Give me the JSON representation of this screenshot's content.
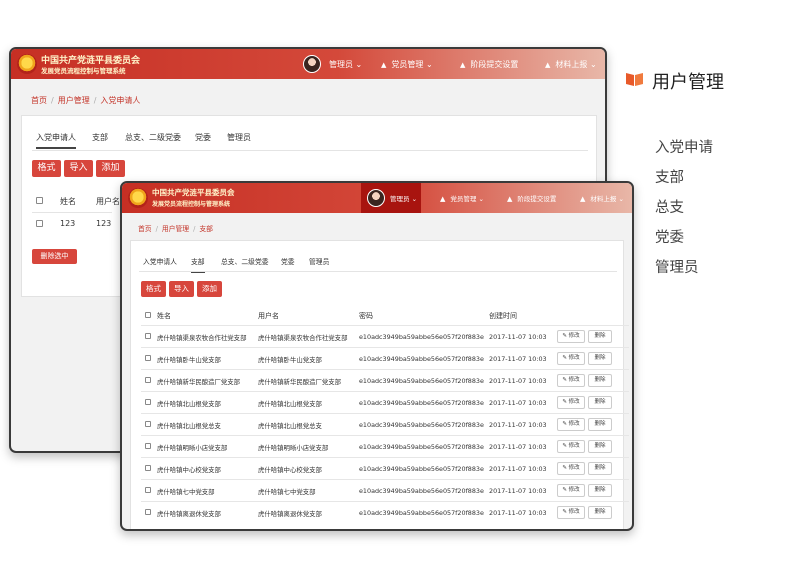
{
  "header": {
    "org_title": "中国共产党涟平县委员会",
    "org_subtitle": "发展党员流程控制与管理系统",
    "menu_admin": "管理员",
    "menu_party_manage": "党员管理",
    "menu_stage_settings": "阶段提交设置",
    "menu_material_report": "材料上报"
  },
  "back_window": {
    "breadcrumb": {
      "home": "首页",
      "level2": "用户管理",
      "level3": "入党申请人"
    },
    "tabs": [
      "入党申请人",
      "支部",
      "总支、二级党委",
      "党委",
      "管理员"
    ],
    "buttons": {
      "format": "格式",
      "import": "导入",
      "add": "添加"
    },
    "table": {
      "headers": [
        "姓名",
        "用户名"
      ],
      "rows": [
        [
          "123",
          "123"
        ]
      ]
    },
    "delete_selected": "删除选中"
  },
  "front_window": {
    "breadcrumb": {
      "home": "首页",
      "level2": "用户管理",
      "level3": "支部"
    },
    "tabs": [
      "入党申请人",
      "支部",
      "总支、二级党委",
      "党委",
      "管理员"
    ],
    "buttons": {
      "format": "格式",
      "import": "导入",
      "add": "添加"
    },
    "table": {
      "headers": [
        "姓名",
        "用户名",
        "密码",
        "创建时间"
      ],
      "edit_label": "修改",
      "delete_label": "删除",
      "rows": [
        {
          "name": "虎什哈镇渠泉农牧合作社党支部",
          "username": "虎什哈镇渠泉农牧合作社党支部",
          "password": "e10adc3949ba59abbe56e057f20f883e",
          "created": "2017-11-07 10:03"
        },
        {
          "name": "虎什哈镇卧牛山党支部",
          "username": "虎什哈镇卧牛山党支部",
          "password": "e10adc3949ba59abbe56e057f20f883e",
          "created": "2017-11-07 10:03"
        },
        {
          "name": "虎什哈镇新华民酿造厂党支部",
          "username": "虎什哈镇新华民酿造厂党支部",
          "password": "e10adc3949ba59abbe56e057f20f883e",
          "created": "2017-11-07 10:03"
        },
        {
          "name": "虎什哈镇北山根党支部",
          "username": "虎什哈镇北山根党支部",
          "password": "e10adc3949ba59abbe56e057f20f883e",
          "created": "2017-11-07 10:03"
        },
        {
          "name": "虎什哈镇北山根党总支",
          "username": "虎什哈镇北山根党总支",
          "password": "e10adc3949ba59abbe56e057f20f883e",
          "created": "2017-11-07 10:03"
        },
        {
          "name": "虎什哈镇明晰小店党支部",
          "username": "虎什哈镇明晰小店党支部",
          "password": "e10adc3949ba59abbe56e057f20f883e",
          "created": "2017-11-07 10:03"
        },
        {
          "name": "虎什哈镇中心校党支部",
          "username": "虎什哈镇中心校党支部",
          "password": "e10adc3949ba59abbe56e057f20f883e",
          "created": "2017-11-07 10:03"
        },
        {
          "name": "虎什哈镇七中党支部",
          "username": "虎什哈镇七中党支部",
          "password": "e10adc3949ba59abbe56e057f20f883e",
          "created": "2017-11-07 10:03"
        },
        {
          "name": "虎什哈镇离退休党支部",
          "username": "虎什哈镇离退休党支部",
          "password": "e10adc3949ba59abbe56e057f20f883e",
          "created": "2017-11-07 10:03"
        }
      ]
    }
  },
  "sidebar": {
    "title": "用户管理",
    "items": [
      "入党申请",
      "支部",
      "总支",
      "党委",
      "管理员"
    ]
  },
  "colors": {
    "brand_red": "#d7463c",
    "header_red": "#c62f24",
    "accent_orange": "#e85a2a"
  }
}
